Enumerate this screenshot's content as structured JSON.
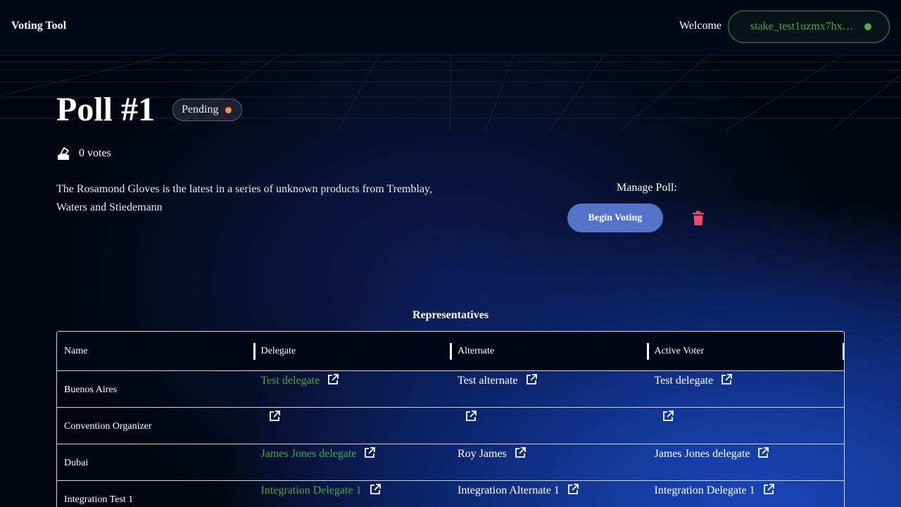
{
  "header": {
    "brand": "Voting Tool",
    "welcome": "Welcome",
    "stake_address": "stake_test1uzmx7hx…",
    "stake_status_color": "#4caf50"
  },
  "poll": {
    "title": "Poll #1",
    "status": "Pending",
    "status_color": "#f0964a",
    "votes": "0 votes",
    "description": "The Rosamond Gloves is the latest in a series of unknown products from Tremblay, Waters and Stiedemann"
  },
  "manage": {
    "label": "Manage Poll:",
    "begin_button": "Begin Voting",
    "delete_icon": "trash-icon"
  },
  "representatives": {
    "title": "Representatives",
    "columns": [
      "Name",
      "Delegate",
      "Alternate",
      "Active Voter"
    ],
    "rows": [
      {
        "name": "Buenos Aires",
        "delegate": "Test delegate",
        "alternate": "Test alternate",
        "active_voter": "Test delegate"
      },
      {
        "name": "Convention Organizer",
        "delegate": "",
        "alternate": "",
        "active_voter": ""
      },
      {
        "name": "Dubai",
        "delegate": "James Jones delegate",
        "alternate": "Roy James",
        "active_voter": "James Jones delegate"
      },
      {
        "name": "Integration Test 1",
        "delegate": "Integration Delegate 1",
        "alternate": "Integration Alternate 1",
        "active_voter": "Integration Delegate 1"
      }
    ]
  }
}
